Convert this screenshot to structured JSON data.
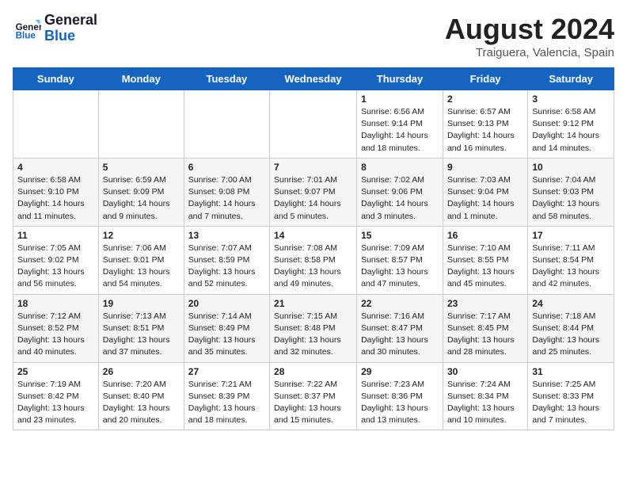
{
  "header": {
    "logo_line1": "General",
    "logo_line2": "Blue",
    "month_year": "August 2024",
    "location": "Traiguera, Valencia, Spain"
  },
  "days_of_week": [
    "Sunday",
    "Monday",
    "Tuesday",
    "Wednesday",
    "Thursday",
    "Friday",
    "Saturday"
  ],
  "weeks": [
    [
      {
        "day": "",
        "content": ""
      },
      {
        "day": "",
        "content": ""
      },
      {
        "day": "",
        "content": ""
      },
      {
        "day": "",
        "content": ""
      },
      {
        "day": "1",
        "content": "Sunrise: 6:56 AM\nSunset: 9:14 PM\nDaylight: 14 hours\nand 18 minutes."
      },
      {
        "day": "2",
        "content": "Sunrise: 6:57 AM\nSunset: 9:13 PM\nDaylight: 14 hours\nand 16 minutes."
      },
      {
        "day": "3",
        "content": "Sunrise: 6:58 AM\nSunset: 9:12 PM\nDaylight: 14 hours\nand 14 minutes."
      }
    ],
    [
      {
        "day": "4",
        "content": "Sunrise: 6:58 AM\nSunset: 9:10 PM\nDaylight: 14 hours\nand 11 minutes."
      },
      {
        "day": "5",
        "content": "Sunrise: 6:59 AM\nSunset: 9:09 PM\nDaylight: 14 hours\nand 9 minutes."
      },
      {
        "day": "6",
        "content": "Sunrise: 7:00 AM\nSunset: 9:08 PM\nDaylight: 14 hours\nand 7 minutes."
      },
      {
        "day": "7",
        "content": "Sunrise: 7:01 AM\nSunset: 9:07 PM\nDaylight: 14 hours\nand 5 minutes."
      },
      {
        "day": "8",
        "content": "Sunrise: 7:02 AM\nSunset: 9:06 PM\nDaylight: 14 hours\nand 3 minutes."
      },
      {
        "day": "9",
        "content": "Sunrise: 7:03 AM\nSunset: 9:04 PM\nDaylight: 14 hours\nand 1 minute."
      },
      {
        "day": "10",
        "content": "Sunrise: 7:04 AM\nSunset: 9:03 PM\nDaylight: 13 hours\nand 58 minutes."
      }
    ],
    [
      {
        "day": "11",
        "content": "Sunrise: 7:05 AM\nSunset: 9:02 PM\nDaylight: 13 hours\nand 56 minutes."
      },
      {
        "day": "12",
        "content": "Sunrise: 7:06 AM\nSunset: 9:01 PM\nDaylight: 13 hours\nand 54 minutes."
      },
      {
        "day": "13",
        "content": "Sunrise: 7:07 AM\nSunset: 8:59 PM\nDaylight: 13 hours\nand 52 minutes."
      },
      {
        "day": "14",
        "content": "Sunrise: 7:08 AM\nSunset: 8:58 PM\nDaylight: 13 hours\nand 49 minutes."
      },
      {
        "day": "15",
        "content": "Sunrise: 7:09 AM\nSunset: 8:57 PM\nDaylight: 13 hours\nand 47 minutes."
      },
      {
        "day": "16",
        "content": "Sunrise: 7:10 AM\nSunset: 8:55 PM\nDaylight: 13 hours\nand 45 minutes."
      },
      {
        "day": "17",
        "content": "Sunrise: 7:11 AM\nSunset: 8:54 PM\nDaylight: 13 hours\nand 42 minutes."
      }
    ],
    [
      {
        "day": "18",
        "content": "Sunrise: 7:12 AM\nSunset: 8:52 PM\nDaylight: 13 hours\nand 40 minutes."
      },
      {
        "day": "19",
        "content": "Sunrise: 7:13 AM\nSunset: 8:51 PM\nDaylight: 13 hours\nand 37 minutes."
      },
      {
        "day": "20",
        "content": "Sunrise: 7:14 AM\nSunset: 8:49 PM\nDaylight: 13 hours\nand 35 minutes."
      },
      {
        "day": "21",
        "content": "Sunrise: 7:15 AM\nSunset: 8:48 PM\nDaylight: 13 hours\nand 32 minutes."
      },
      {
        "day": "22",
        "content": "Sunrise: 7:16 AM\nSunset: 8:47 PM\nDaylight: 13 hours\nand 30 minutes."
      },
      {
        "day": "23",
        "content": "Sunrise: 7:17 AM\nSunset: 8:45 PM\nDaylight: 13 hours\nand 28 minutes."
      },
      {
        "day": "24",
        "content": "Sunrise: 7:18 AM\nSunset: 8:44 PM\nDaylight: 13 hours\nand 25 minutes."
      }
    ],
    [
      {
        "day": "25",
        "content": "Sunrise: 7:19 AM\nSunset: 8:42 PM\nDaylight: 13 hours\nand 23 minutes."
      },
      {
        "day": "26",
        "content": "Sunrise: 7:20 AM\nSunset: 8:40 PM\nDaylight: 13 hours\nand 20 minutes."
      },
      {
        "day": "27",
        "content": "Sunrise: 7:21 AM\nSunset: 8:39 PM\nDaylight: 13 hours\nand 18 minutes."
      },
      {
        "day": "28",
        "content": "Sunrise: 7:22 AM\nSunset: 8:37 PM\nDaylight: 13 hours\nand 15 minutes."
      },
      {
        "day": "29",
        "content": "Sunrise: 7:23 AM\nSunset: 8:36 PM\nDaylight: 13 hours\nand 13 minutes."
      },
      {
        "day": "30",
        "content": "Sunrise: 7:24 AM\nSunset: 8:34 PM\nDaylight: 13 hours\nand 10 minutes."
      },
      {
        "day": "31",
        "content": "Sunrise: 7:25 AM\nSunset: 8:33 PM\nDaylight: 13 hours\nand 7 minutes."
      }
    ]
  ]
}
